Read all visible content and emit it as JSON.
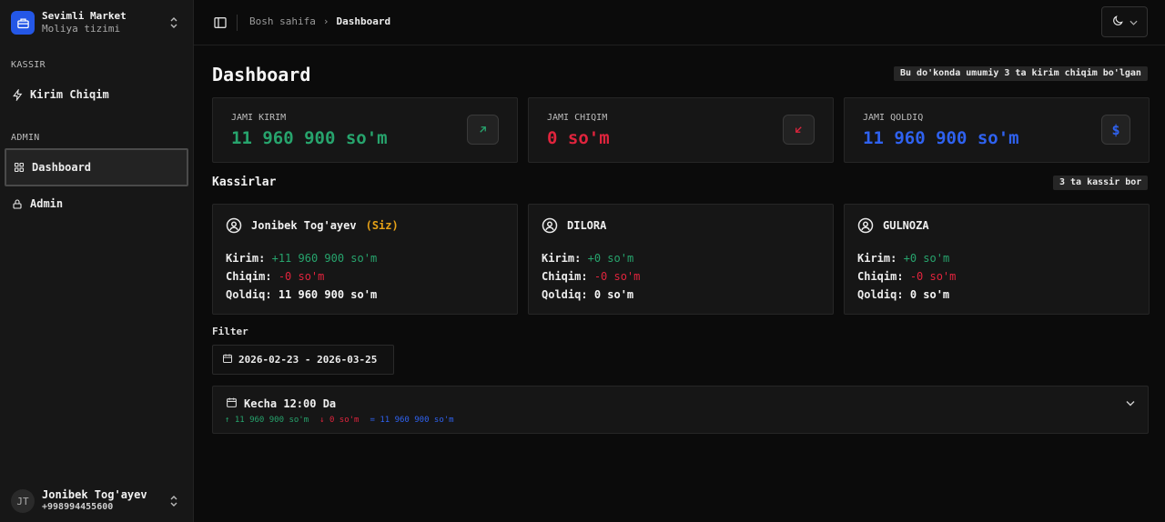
{
  "colors": {
    "green": "#27a46d",
    "red": "#e0243d",
    "blue": "#2f62f0",
    "accent_brand": "#2457e6",
    "you": "#e6a117"
  },
  "brand": {
    "name": "Sevimli Market",
    "subtitle": "Moliya tizimi",
    "icon": "store-icon"
  },
  "sidebar": {
    "sections": [
      {
        "label": "KASSIR",
        "items": [
          {
            "label": "Kirim Chiqim",
            "icon": "bolt-icon",
            "active": false
          }
        ]
      },
      {
        "label": "ADMIN",
        "items": [
          {
            "label": "Dashboard",
            "icon": "grid-icon",
            "active": true
          },
          {
            "label": "Admin",
            "icon": "lock-icon",
            "active": false
          }
        ]
      }
    ]
  },
  "user": {
    "initials": "JT",
    "name": "Jonibek Tog'ayev",
    "phone": "+998994455600"
  },
  "breadcrumb": {
    "home": "Bosh sahifa",
    "current": "Dashboard"
  },
  "page": {
    "title": "Dashboard",
    "info_badge": "Bu do'konda umumiy 3 ta kirim chiqim bo'lgan"
  },
  "stats": [
    {
      "label": "JAMI KIRIM",
      "value": "11 960 900 so'm",
      "icon": "arrow-up-right-icon"
    },
    {
      "label": "JAMI CHIQIM",
      "value": "0 so'm",
      "icon": "arrow-down-left-icon"
    },
    {
      "label": "JAMI QOLDIQ",
      "value": "11 960 900 so'm",
      "icon": "dollar-icon"
    }
  ],
  "cashiers": {
    "title": "Kassirlar",
    "count_badge": "3 ta kassir bor",
    "labels": {
      "income": "Kirim:",
      "expense": "Chiqim:",
      "balance": "Qoldiq:"
    },
    "items": [
      {
        "name": "Jonibek Tog'ayev",
        "you": "(Siz)",
        "income": "+11 960 900 so'm",
        "expense": "-0 so'm",
        "balance": "11 960 900 so'm"
      },
      {
        "name": "DILORA",
        "you": "",
        "income": "+0 so'm",
        "expense": "-0 so'm",
        "balance": "0 so'm"
      },
      {
        "name": "GULNOZA",
        "you": "",
        "income": "+0 so'm",
        "expense": "-0 so'm",
        "balance": "0 so'm"
      }
    ]
  },
  "filter": {
    "label": "Filter",
    "date_range": "2026-02-23 - 2026-03-25"
  },
  "day": {
    "title": "Kecha 12:00 Da",
    "income": "↑ 11 960 900 so'm",
    "expense": "↓ 0 so'm",
    "balance": "= 11 960 900 so'm"
  }
}
